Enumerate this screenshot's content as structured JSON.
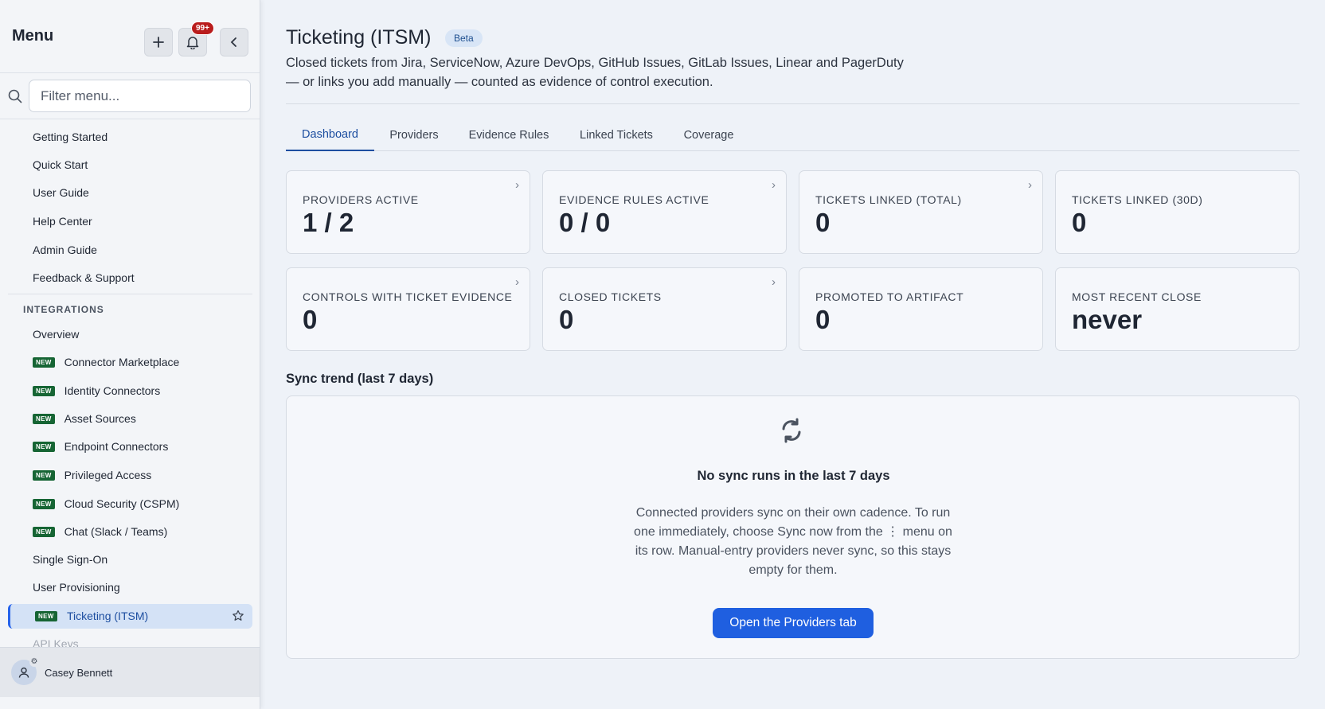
{
  "sidebar": {
    "title": "Menu",
    "notification_count": "99+",
    "search_placeholder": "Filter menu...",
    "items": [
      {
        "label": "Getting Started"
      },
      {
        "label": "Quick Start"
      },
      {
        "label": "User Guide"
      },
      {
        "label": "Help Center"
      },
      {
        "label": "Admin Guide"
      },
      {
        "label": "Feedback & Support"
      }
    ],
    "section_integrations": "INTEGRATIONS",
    "integrations": [
      {
        "label": "Overview",
        "new": false
      },
      {
        "label": "Connector Marketplace",
        "new": true
      },
      {
        "label": "Identity Connectors",
        "new": true
      },
      {
        "label": "Asset Sources",
        "new": true
      },
      {
        "label": "Endpoint Connectors",
        "new": true
      },
      {
        "label": "Privileged Access",
        "new": true
      },
      {
        "label": "Cloud Security (CSPM)",
        "new": true
      },
      {
        "label": "Chat (Slack / Teams)",
        "new": true
      },
      {
        "label": "Single Sign-On",
        "new": false
      },
      {
        "label": "User Provisioning",
        "new": false
      },
      {
        "label": "Ticketing (ITSM)",
        "new": true,
        "active": true
      },
      {
        "label": "API Keys",
        "new": false
      }
    ],
    "new_tag": "NEW",
    "user_name": "Casey Bennett"
  },
  "page": {
    "title": "Ticketing (ITSM)",
    "badge": "Beta",
    "description_line1": "Closed tickets from Jira, ServiceNow, Azure DevOps, GitHub Issues, GitLab Issues, Linear and PagerDuty",
    "description_line2": "— or links you add manually — counted as evidence of control execution."
  },
  "tabs": [
    {
      "label": "Dashboard",
      "active": true
    },
    {
      "label": "Providers"
    },
    {
      "label": "Evidence Rules"
    },
    {
      "label": "Linked Tickets"
    },
    {
      "label": "Coverage"
    }
  ],
  "cards": [
    {
      "label": "PROVIDERS ACTIVE",
      "value": "1 / 2",
      "link": true
    },
    {
      "label": "EVIDENCE RULES ACTIVE",
      "value": "0 / 0",
      "link": true
    },
    {
      "label": "TICKETS LINKED (TOTAL)",
      "value": "0",
      "link": true
    },
    {
      "label": "TICKETS LINKED (30D)",
      "value": "0",
      "link": false
    },
    {
      "label": "CONTROLS WITH TICKET EVIDENCE",
      "value": "0",
      "link": true
    },
    {
      "label": "CLOSED TICKETS",
      "value": "0",
      "link": true
    },
    {
      "label": "PROMOTED TO ARTIFACT",
      "value": "0",
      "link": false
    },
    {
      "label": "MOST RECENT CLOSE",
      "value": "never",
      "link": false
    }
  ],
  "sync": {
    "title": "Sync trend (last 7 days)",
    "empty_title": "No sync runs in the last 7 days",
    "empty_text": "Connected providers sync on their own cadence. To run one immediately, choose Sync now from the ⋮ menu on its row. Manual-entry providers never sync, so this stays empty for them.",
    "button_label": "Open the Providers tab"
  },
  "colors": {
    "accent": "#1f5fe0",
    "new_tag": "#166534",
    "badge_alert": "#b91c1c"
  }
}
